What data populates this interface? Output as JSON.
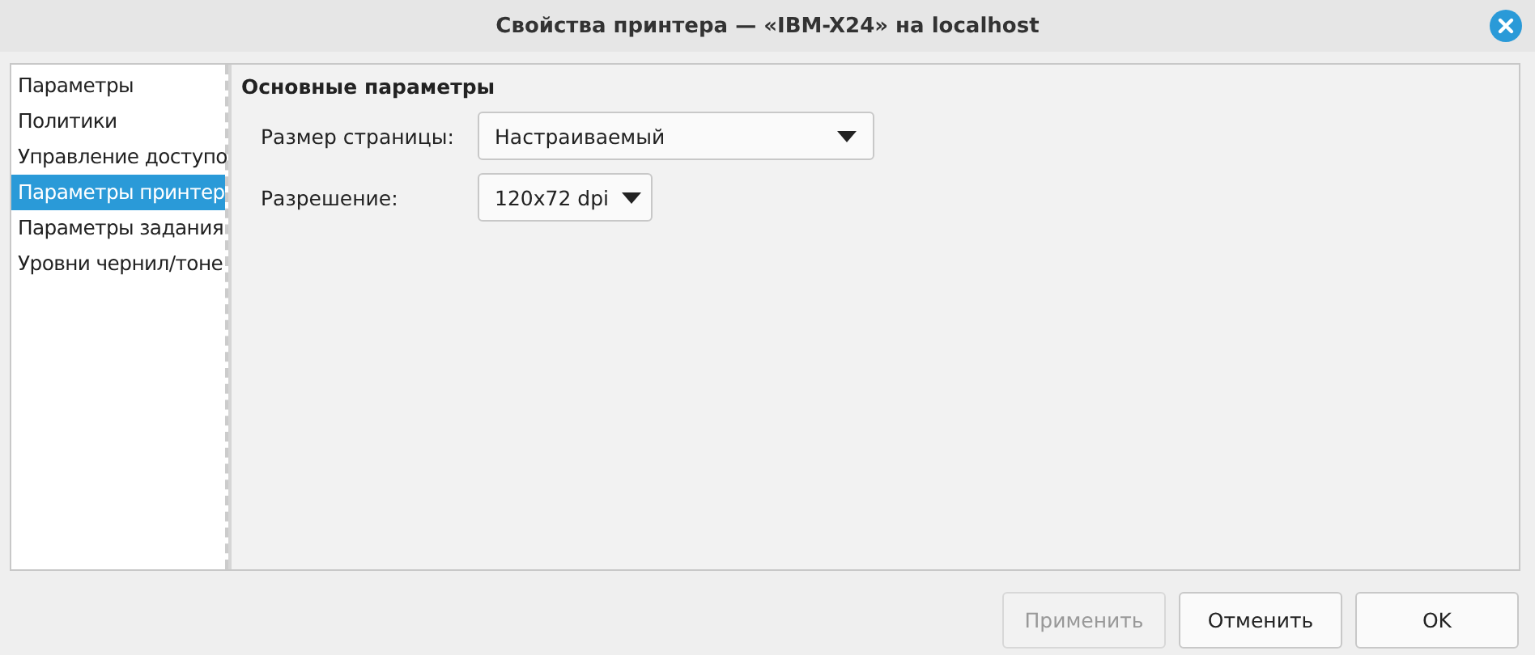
{
  "window": {
    "title": "Свойства принтера — «IBM-X24» на localhost"
  },
  "sidebar": {
    "items": [
      {
        "label": "Параметры",
        "selected": false
      },
      {
        "label": "Политики",
        "selected": false
      },
      {
        "label": "Управление доступо",
        "selected": false
      },
      {
        "label": "Параметры принтер",
        "selected": true
      },
      {
        "label": "Параметры задания",
        "selected": false
      },
      {
        "label": "Уровни чернил/тоне",
        "selected": false
      }
    ]
  },
  "panel": {
    "heading": "Основные параметры",
    "fields": [
      {
        "label": "Размер страницы:",
        "value": "Настраиваемый",
        "kind": "wide"
      },
      {
        "label": "Разрешение:",
        "value": "120x72 dpi",
        "kind": "narrow"
      }
    ]
  },
  "buttons": [
    {
      "label": "Применить",
      "disabled": true
    },
    {
      "label": "Отменить",
      "disabled": false
    },
    {
      "label": "OK",
      "disabled": false
    }
  ]
}
